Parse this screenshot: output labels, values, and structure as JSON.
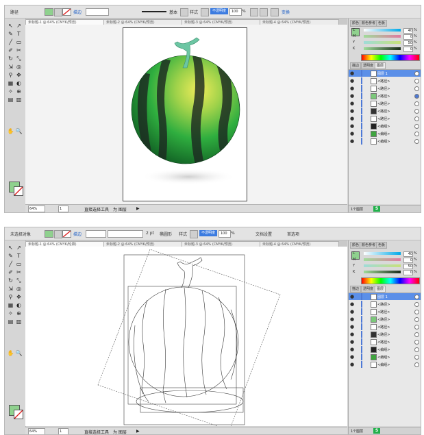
{
  "shots": [
    {
      "control_bar": {
        "selection_label": "路径",
        "stroke_label": "描边",
        "stroke_weight": "",
        "profile_label": "基本",
        "style_label": "样式",
        "opacity_label": "不透明度",
        "opacity_value": "100",
        "opacity_unit": "%",
        "transform_label": "变换"
      },
      "tabs": [
        "未标题-1 @ 64% (CMYK/预览)",
        "未标题-2 @ 64% (CMYK/预览)",
        "未标题-3 @ 64% (CMYK/预览)",
        "未标题-4 @ 64% (CMYK/预览)"
      ],
      "canvas_mode": "preview",
      "status": {
        "zoom": "64%",
        "page": "1",
        "tool": "直接选择工具",
        "extra": "为 图层",
        "arrow": "▶"
      }
    },
    {
      "control_bar": {
        "selection_label": "未选择对象",
        "stroke_label": "描边",
        "stroke_weight": "2 pt",
        "profile_label": "椭圆形",
        "style_label": "样式",
        "opacity_label": "不透明度",
        "opacity_value": "100",
        "opacity_unit": "%",
        "doc_setup_label": "文档设置",
        "prefs_label": "首选项"
      },
      "tabs": [
        "未标题-1 @ 64% (CMYK/轮廓)",
        "未标题-2 @ 64% (CMYK/预览)",
        "未标题-3 @ 64% (CMYK/预览)",
        "未标题-4 @ 64% (CMYK/预览)"
      ],
      "canvas_mode": "outline",
      "status": {
        "zoom": "64%",
        "page": "1",
        "tool": "直接选择工具",
        "extra": "为 图层",
        "arrow": "▶"
      }
    }
  ],
  "panel": {
    "tabs": [
      "颜色",
      "颜色参考",
      "色板",
      "描边",
      "透明度",
      "图层"
    ],
    "color": {
      "channels": [
        {
          "name": "C",
          "value": "40"
        },
        {
          "name": "M",
          "value": "0"
        },
        {
          "name": "Y",
          "value": "50"
        },
        {
          "name": "K",
          "value": "0"
        }
      ],
      "unit": "%"
    },
    "layers": [
      {
        "name": "图层 1",
        "selected": true,
        "thumb": "#ffffff"
      },
      {
        "name": "<路径>",
        "selected": false,
        "thumb": "#ffffff"
      },
      {
        "name": "<路径>",
        "selected": false,
        "thumb": "#ffffff"
      },
      {
        "name": "<路径>",
        "selected": false,
        "thumb": "#7cc87a"
      },
      {
        "name": "<路径>",
        "selected": false,
        "thumb": "#ffffff"
      },
      {
        "name": "<路径>",
        "selected": false,
        "thumb": "#333333"
      },
      {
        "name": "<路径>",
        "selected": false,
        "thumb": "#ffffff"
      },
      {
        "name": "<编组>",
        "selected": false,
        "thumb": "#222222"
      },
      {
        "name": "<编组>",
        "selected": false,
        "thumb": "#3fa53f"
      },
      {
        "name": "<编组>",
        "selected": false,
        "thumb": "#ffffff"
      }
    ],
    "footer_label": "1个图层",
    "sg_logo": "S"
  },
  "tools": [
    "↖",
    "↗",
    "✎",
    "T",
    "╱",
    "▭",
    "✐",
    "✂",
    "↻",
    "⤡",
    "⇲",
    "◎",
    "⚲",
    "✥",
    "▦",
    "◐",
    "✧",
    "⊕",
    "▤",
    "▥",
    "✋",
    "🔍"
  ],
  "colors": {
    "fill": "#8fd18e",
    "accent": "#3b7be0",
    "layer_select": "#5b8fe8"
  }
}
